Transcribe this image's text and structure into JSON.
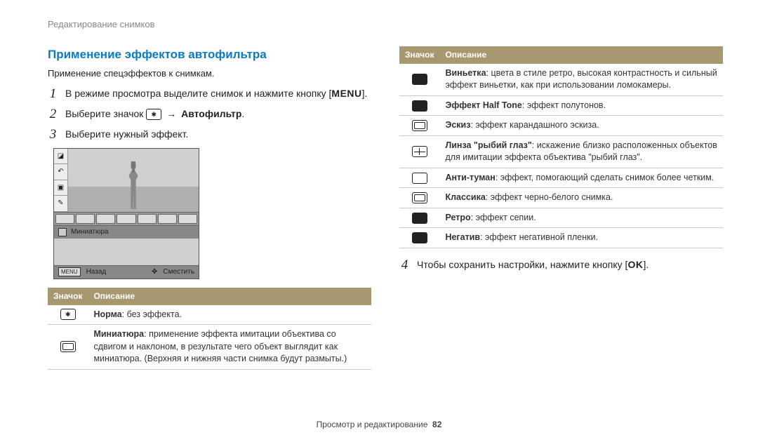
{
  "breadcrumb": "Редактирование снимков",
  "section_title": "Применение эффектов автофильтра",
  "subtitle": "Применение спецэффектов к снимкам.",
  "steps": {
    "s1_num": "1",
    "s1_body_a": "В режиме просмотра выделите снимок и нажмите кнопку [",
    "s1_body_kbd": "MENU",
    "s1_body_b": "].",
    "s2_num": "2",
    "s2_body_a": "Выберите значок ",
    "s2_arrow": "→",
    "s2_bold": "Автофильтр",
    "s2_body_b": ".",
    "s3_num": "3",
    "s3_body": "Выберите нужный эффект.",
    "s4_num": "4",
    "s4_body_a": "Чтобы сохранить настройки, нажмите кнопку [",
    "s4_kbd": "OK",
    "s4_body_b": "]."
  },
  "screenshot": {
    "selected_label": "Миниатюра",
    "back_btn": "MENU",
    "back_label": "Назад",
    "move_label": "Сместить"
  },
  "table_headers": {
    "icon": "Значок",
    "desc": "Описание"
  },
  "left_rows": [
    {
      "bold": "Норма",
      "rest": ": без эффекта."
    },
    {
      "bold": "Миниатюра",
      "rest": ": применение эффекта имитации объектива со сдвигом и наклоном, в результате чего объект выглядит как миниатюра. (Верхняя и нижняя части снимка будут размыты.)"
    }
  ],
  "right_rows": [
    {
      "bold": "Виньетка",
      "rest": ": цвета в стиле ретро, высокая контрастность и сильный эффект виньетки, как при использовании ломокамеры."
    },
    {
      "bold": "Эффект Half Tone",
      "rest": ": эффект полутонов."
    },
    {
      "bold": "Эскиз",
      "rest": ": эффект карандашного эскиза."
    },
    {
      "bold": "Линза \"рыбий глаз\"",
      "rest": ": искажение близко расположенных объектов для имитации эффекта объектива \"рыбий глаз\"."
    },
    {
      "bold": "Анти-туман",
      "rest": ": эффект, помогающий сделать снимок более четким."
    },
    {
      "bold": "Классика",
      "rest": ": эффект черно-белого снимка."
    },
    {
      "bold": "Ретро",
      "rest": ": эффект сепии."
    },
    {
      "bold": "Негатив",
      "rest": ": эффект негативной пленки."
    }
  ],
  "footer_label": "Просмотр и редактирование",
  "footer_page": "82"
}
